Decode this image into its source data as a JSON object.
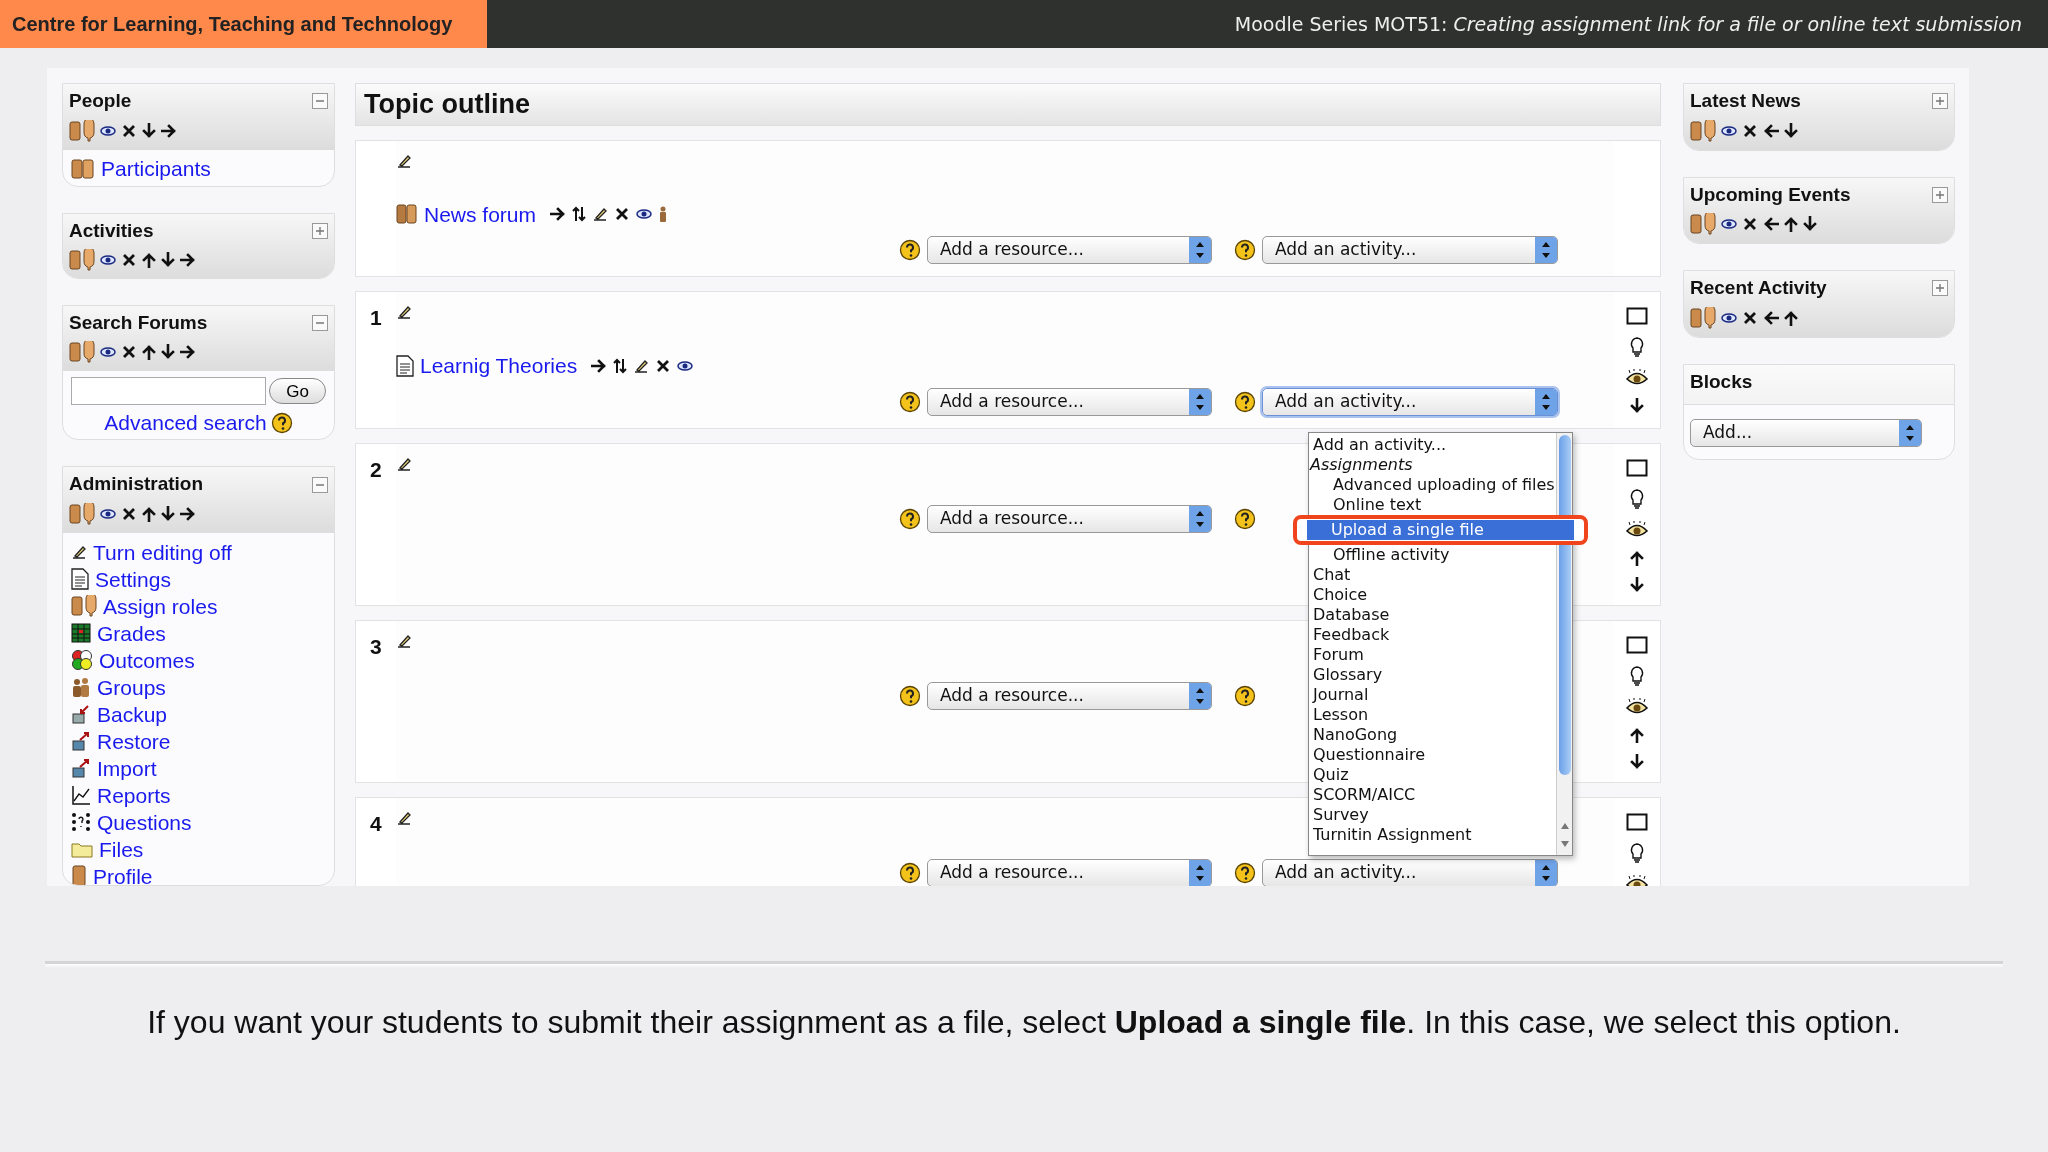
{
  "header": {
    "org": "Centre for Learning, Teaching and Technology",
    "series": "Moodle Series MOT51:",
    "subtitle": "Creating assignment link for a file or online text submission"
  },
  "left_blocks": [
    {
      "title": "People",
      "expanded": true,
      "controls": [
        {
          "kind": "roles"
        },
        {
          "kind": "eye"
        },
        {
          "kind": "x"
        },
        {
          "kind": "down"
        },
        {
          "kind": "right"
        }
      ],
      "kind": "links",
      "links": [
        {
          "kind": "participants",
          "label": "Participants"
        }
      ]
    },
    {
      "title": "Activities",
      "expanded": false,
      "controls": [
        {
          "kind": "roles"
        },
        {
          "kind": "eye"
        },
        {
          "kind": "x"
        },
        {
          "kind": "up"
        },
        {
          "kind": "down"
        },
        {
          "kind": "right"
        }
      ],
      "kind": "empty"
    },
    {
      "title": "Search Forums",
      "expanded": true,
      "controls": [
        {
          "kind": "roles"
        },
        {
          "kind": "eye"
        },
        {
          "kind": "x"
        },
        {
          "kind": "up"
        },
        {
          "kind": "down"
        },
        {
          "kind": "right"
        }
      ],
      "kind": "search",
      "button": "Go",
      "link": "Advanced search"
    },
    {
      "title": "Administration",
      "expanded": true,
      "controls": [
        {
          "kind": "roles"
        },
        {
          "kind": "eye"
        },
        {
          "kind": "x"
        },
        {
          "kind": "up"
        },
        {
          "kind": "down"
        },
        {
          "kind": "right"
        }
      ],
      "kind": "links",
      "links": [
        {
          "kind": "edit",
          "label": "Turn editing off"
        },
        {
          "kind": "doc",
          "label": "Settings"
        },
        {
          "kind": "roles",
          "label": "Assign roles"
        },
        {
          "kind": "grades",
          "label": "Grades"
        },
        {
          "kind": "outcomes",
          "label": "Outcomes"
        },
        {
          "kind": "groups",
          "label": "Groups"
        },
        {
          "kind": "backup",
          "label": "Backup"
        },
        {
          "kind": "restore",
          "label": "Restore"
        },
        {
          "kind": "restore",
          "label": "Import"
        },
        {
          "kind": "reports",
          "label": "Reports"
        },
        {
          "kind": "questions",
          "label": "Questions"
        },
        {
          "kind": "folder",
          "label": "Files"
        },
        {
          "kind": "profile",
          "label": "Profile"
        }
      ]
    }
  ],
  "topic_outline": {
    "title": "Topic outline",
    "sections": [
      {
        "items": [
          {
            "kind": "forum",
            "label": "News forum",
            "controls": [
              {
                "kind": "right"
              },
              {
                "kind": "move"
              },
              {
                "kind": "edit"
              },
              {
                "kind": "x"
              },
              {
                "kind": "eye"
              },
              {
                "kind": "person"
              }
            ]
          }
        ],
        "resource_select": "Add a resource...",
        "activity_select": "Add an activity..."
      },
      {
        "number": "1",
        "items": [
          {
            "kind": "doc",
            "label": "Learnig Theories",
            "controls": [
              {
                "kind": "right"
              },
              {
                "kind": "move"
              },
              {
                "kind": "edit"
              },
              {
                "kind": "x"
              },
              {
                "kind": "eye"
              }
            ]
          }
        ],
        "resource_select": "Add a resource...",
        "activity_select": "Add an activity...",
        "activity_open": true,
        "side_controls": [
          {
            "kind": "square"
          },
          {
            "kind": "bulb"
          },
          {
            "kind": "eyebig"
          },
          {
            "kind": "down"
          }
        ]
      },
      {
        "number": "2",
        "resource_select": "Add a resource...",
        "side_controls": [
          {
            "kind": "square"
          },
          {
            "kind": "bulb"
          },
          {
            "kind": "eyebig"
          },
          {
            "kind": "up"
          },
          {
            "kind": "down"
          }
        ]
      },
      {
        "number": "3",
        "resource_select": "Add a resource...",
        "side_controls": [
          {
            "kind": "square"
          },
          {
            "kind": "bulb"
          },
          {
            "kind": "eyebig"
          },
          {
            "kind": "up"
          },
          {
            "kind": "down"
          }
        ]
      },
      {
        "number": "4",
        "resource_select": "Add a resource...",
        "activity_select": "Add an activity...",
        "side_controls": [
          {
            "kind": "square"
          },
          {
            "kind": "bulb"
          },
          {
            "kind": "eyebig"
          }
        ]
      }
    ]
  },
  "activity_dropdown": [
    {
      "kind": "option",
      "label": "Add an activity...",
      "selected": false
    },
    {
      "kind": "group",
      "label": "Assignments",
      "selected": false
    },
    {
      "kind": "suboption",
      "label": "Advanced uploading of files",
      "selected": false
    },
    {
      "kind": "suboption",
      "label": "Online text",
      "selected": false
    },
    {
      "kind": "suboption",
      "label": "Upload a single file",
      "selected": true
    },
    {
      "kind": "suboption",
      "label": "Offline activity",
      "selected": false
    },
    {
      "kind": "option",
      "label": "Chat",
      "selected": false
    },
    {
      "kind": "option",
      "label": "Choice",
      "selected": false
    },
    {
      "kind": "option",
      "label": "Database",
      "selected": false
    },
    {
      "kind": "option",
      "label": "Feedback",
      "selected": false
    },
    {
      "kind": "option",
      "label": "Forum",
      "selected": false
    },
    {
      "kind": "option",
      "label": "Glossary",
      "selected": false
    },
    {
      "kind": "option",
      "label": "Journal",
      "selected": false
    },
    {
      "kind": "option",
      "label": "Lesson",
      "selected": false
    },
    {
      "kind": "option",
      "label": "NanoGong",
      "selected": false
    },
    {
      "kind": "option",
      "label": "Questionnaire",
      "selected": false
    },
    {
      "kind": "option",
      "label": "Quiz",
      "selected": false
    },
    {
      "kind": "option",
      "label": "SCORM/AICC",
      "selected": false
    },
    {
      "kind": "option",
      "label": "Survey",
      "selected": false
    },
    {
      "kind": "option",
      "label": "Turnitin Assignment",
      "selected": false
    }
  ],
  "right_blocks": [
    {
      "title": "Latest News",
      "expanded": false,
      "controls": [
        {
          "kind": "roles"
        },
        {
          "kind": "eye"
        },
        {
          "kind": "x"
        },
        {
          "kind": "left"
        },
        {
          "kind": "down"
        }
      ]
    },
    {
      "title": "Upcoming Events",
      "expanded": false,
      "controls": [
        {
          "kind": "roles"
        },
        {
          "kind": "eye"
        },
        {
          "kind": "x"
        },
        {
          "kind": "left"
        },
        {
          "kind": "up"
        },
        {
          "kind": "down"
        }
      ]
    },
    {
      "title": "Recent Activity",
      "expanded": false,
      "controls": [
        {
          "kind": "roles"
        },
        {
          "kind": "eye"
        },
        {
          "kind": "x"
        },
        {
          "kind": "left"
        },
        {
          "kind": "up"
        }
      ]
    },
    {
      "title": "Blocks",
      "select": "Add..."
    }
  ],
  "caption": "If you want your students to submit their assignment as a file, select **Upload a single file**. In this case, we select this option."
}
